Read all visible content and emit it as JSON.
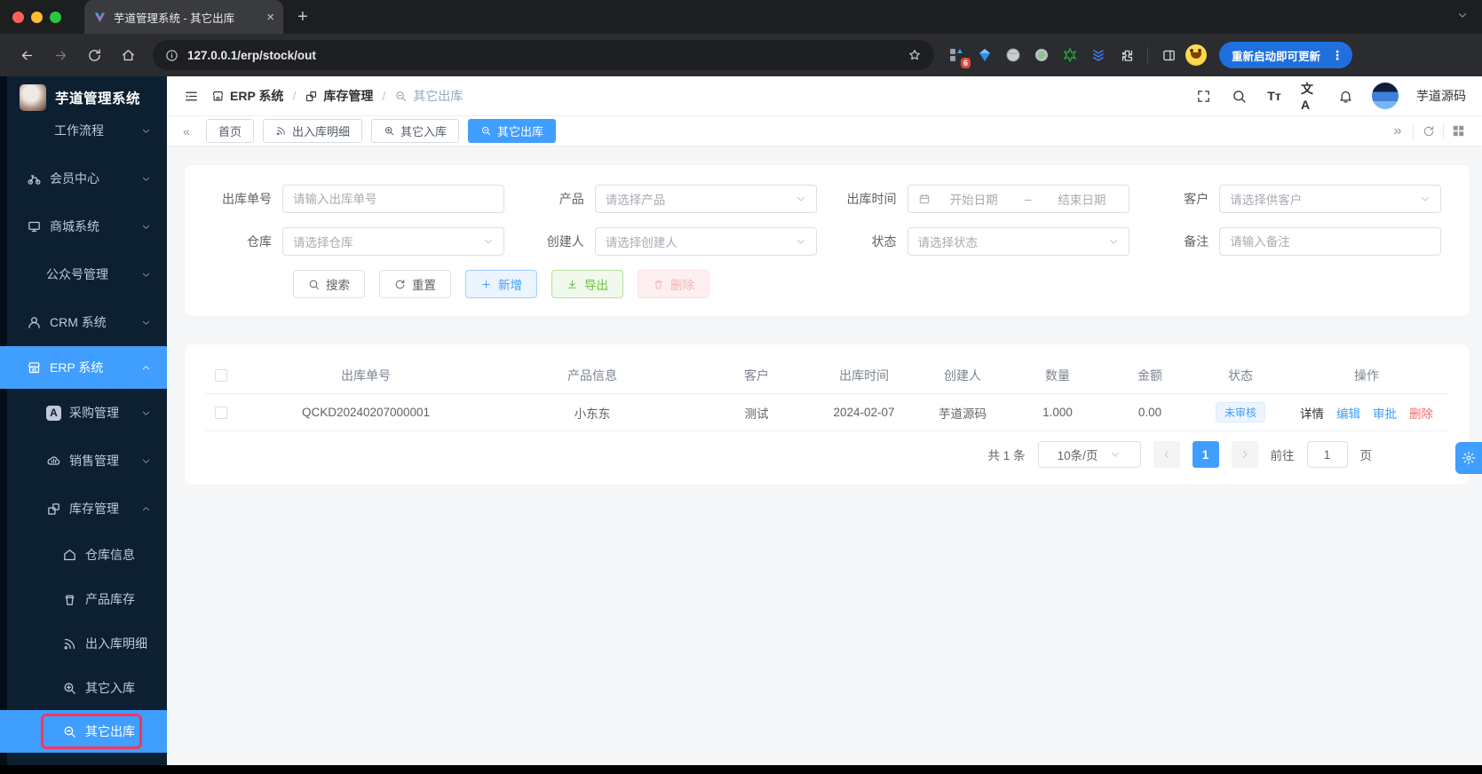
{
  "colors": {
    "accent": "#409EFF",
    "green": "#67C23A",
    "red": "#F56C6C",
    "sidebar": "#0D2032",
    "highlight": "#F5365C"
  },
  "browser": {
    "tab_title": "芋道管理系统 - 其它出库",
    "close_glyph": "×",
    "new_tab_glyph": "+",
    "url": "127.0.0.1/erp/stock/out",
    "extension_badge": "6",
    "update_button": "重新启动即可更新",
    "kebab_glyph": "⋮"
  },
  "sidebar": {
    "app_title": "芋道管理系统",
    "items": [
      {
        "label": "工作流程"
      },
      {
        "label": "会员中心"
      },
      {
        "label": "商城系统"
      },
      {
        "label": "公众号管理"
      },
      {
        "label": "CRM 系统"
      },
      {
        "label": "ERP 系统"
      },
      {
        "label": "采购管理",
        "badge_letter": "A"
      },
      {
        "label": "销售管理"
      },
      {
        "label": "库存管理"
      },
      {
        "label": "仓库信息"
      },
      {
        "label": "产品库存"
      },
      {
        "label": "出入库明细"
      },
      {
        "label": "其它入库"
      },
      {
        "label": "其它出库"
      }
    ]
  },
  "topbar": {
    "breadcrumb": [
      {
        "label": "ERP 系统"
      },
      {
        "label": "库存管理"
      },
      {
        "label": "其它出库"
      }
    ],
    "separator": "/",
    "font_icon_text": "Tт",
    "lang_icon_text": "文A",
    "username": "芋道源码"
  },
  "tabsbar": {
    "collapse_left": "«",
    "collapse_right": "»",
    "tabs": [
      {
        "label": "首页"
      },
      {
        "label": "出入库明细"
      },
      {
        "label": "其它入库"
      },
      {
        "label": "其它出库"
      }
    ]
  },
  "filters": {
    "row1": [
      {
        "label": "出库单号",
        "placeholder": "请输入出库单号"
      },
      {
        "label": "产品",
        "placeholder": "请选择产品"
      },
      {
        "label": "出库时间",
        "start": "开始日期",
        "separator": "–",
        "end": "结束日期"
      },
      {
        "label": "客户",
        "placeholder": "请选择供客户"
      }
    ],
    "row2": [
      {
        "label": "仓库",
        "placeholder": "请选择仓库"
      },
      {
        "label": "创建人",
        "placeholder": "请选择创建人"
      },
      {
        "label": "状态",
        "placeholder": "请选择状态"
      },
      {
        "label": "备注",
        "placeholder": "请输入备注"
      }
    ],
    "buttons": {
      "search": "搜索",
      "reset": "重置",
      "add": "新增",
      "export": "导出",
      "delete": "删除"
    }
  },
  "table": {
    "headers": [
      "出库单号",
      "产品信息",
      "客户",
      "出库时间",
      "创建人",
      "数量",
      "金额",
      "状态",
      "操作"
    ],
    "rows": [
      {
        "order_no": "QCKD20240207000001",
        "product": "小东东",
        "customer": "测试",
        "out_time": "2024-02-07",
        "creator": "芋道源码",
        "quantity": "1.000",
        "amount": "0.00",
        "status": "未审核",
        "actions": {
          "detail": "详情",
          "edit": "编辑",
          "approve": "审批",
          "delete": "删除"
        }
      }
    ]
  },
  "pagination": {
    "total": "共 1 条",
    "page_size": "10条/页",
    "current_page": "1",
    "goto_label": "前往",
    "goto_value": "1",
    "goto_suffix": "页"
  }
}
